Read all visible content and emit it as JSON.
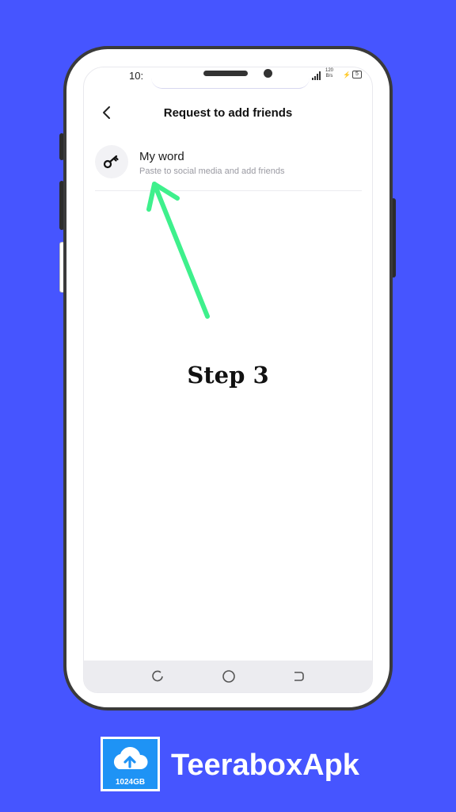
{
  "status_bar": {
    "time": "10:",
    "net_speed_top": "120",
    "net_speed_unit": "B/s",
    "battery": "5"
  },
  "header": {
    "title": "Request to add friends"
  },
  "menu_item": {
    "title": "My word",
    "subtitle": "Paste to social media and add friends"
  },
  "annotation": {
    "step": "Step 3",
    "arrow_color": "#3ef08c"
  },
  "brand": {
    "name": "TeeraboxApk",
    "logo_caption": "1024GB",
    "background": "#4655ff",
    "logo_color": "#1e93f5"
  },
  "icons": {
    "back": "chevron-left-icon",
    "key": "key-icon",
    "recent": "recent-apps-icon",
    "home": "home-icon",
    "back_nav": "back-nav-icon"
  }
}
